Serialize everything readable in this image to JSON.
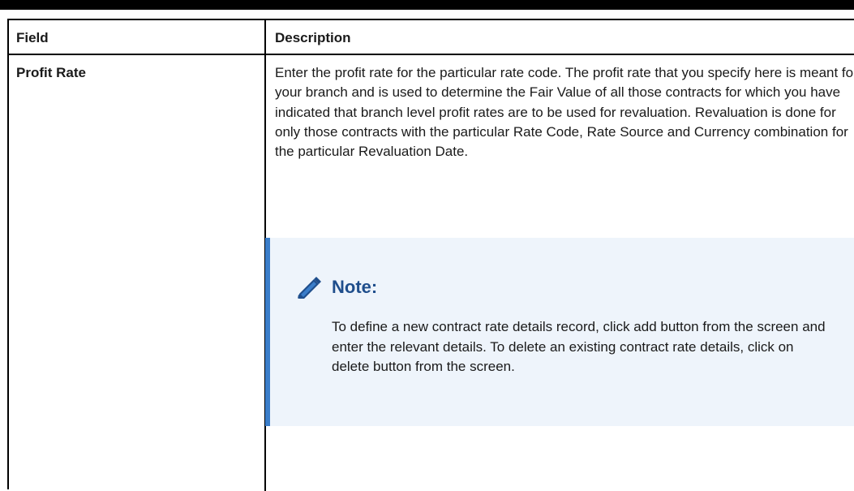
{
  "table": {
    "header": {
      "field": "Field",
      "description": "Description"
    },
    "rows": [
      {
        "field": "Profit Rate",
        "description": "Enter the profit rate for the particular rate code. The profit rate that you specify here is meant for your branch and is used to determine the Fair Value of all those contracts for which you have indicated that branch level profit rates are to be used for revaluation. Revaluation is done for only those contracts with the particular Rate Code, Rate Source and Currency combination for the particular Revaluation Date."
      }
    ]
  },
  "note": {
    "icon": "pencil-icon",
    "title": "Note:",
    "text": "To define a new contract rate details record, click add button from the screen and enter the relevant details. To delete an existing contract rate details, click on delete button from the screen."
  },
  "colors": {
    "note_background": "#eef4fb",
    "note_accent": "#3a7dc9",
    "note_title": "#1f4e8c"
  }
}
